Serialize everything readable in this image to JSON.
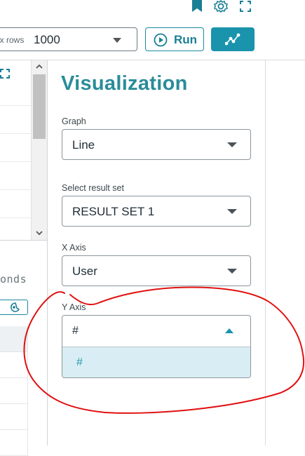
{
  "toolbar": {
    "max_rows_label": "ax rows",
    "max_rows_value": "1000",
    "run_label": "Run"
  },
  "left_panel": {
    "seconds_text": "onds"
  },
  "visualization": {
    "title": "Visualization",
    "graph": {
      "label": "Graph",
      "value": "Line"
    },
    "result_set": {
      "label": "Select result set",
      "value": "RESULT SET 1"
    },
    "x_axis": {
      "label": "X Axis",
      "value": "User"
    },
    "y_axis": {
      "label": "Y Axis",
      "value": "#",
      "options": [
        "#"
      ]
    }
  },
  "colors": {
    "accent": "#1a93ad",
    "title": "#2a8c99",
    "annotation": "#e01010",
    "option_highlight": "#d9eef4"
  }
}
